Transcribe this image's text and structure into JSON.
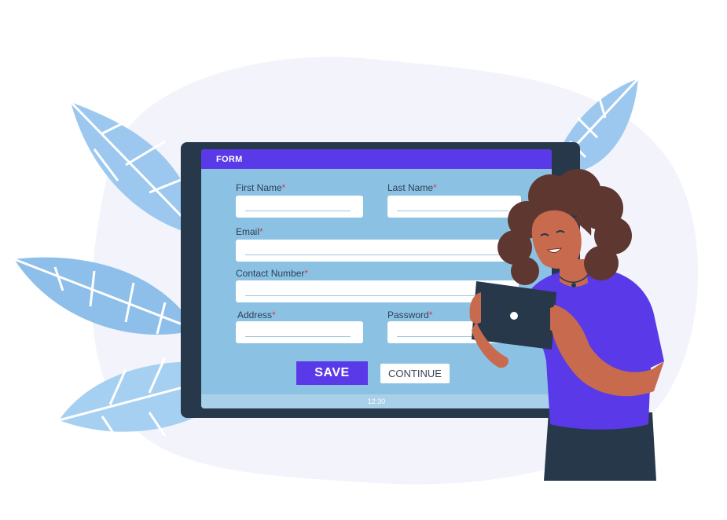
{
  "form": {
    "title": "FORM",
    "first_name_label": "First Name",
    "last_name_label": "Last Name",
    "email_label": "Email",
    "contact_label": "Contact Number",
    "address_label": "Address",
    "password_label": "Password",
    "required_mark": "*",
    "save_label": "SAVE",
    "continue_label": "CONTINUE",
    "clock": "12:30"
  },
  "colors": {
    "accent": "#5a3ae8",
    "monitor": "#26384a",
    "screen": "#8bc2e4",
    "leaf": "#9cc8ef",
    "blob": "#f3f3fb",
    "shirt": "#5a3ae8",
    "skin": "#c76a4e",
    "hair": "#5e3731"
  }
}
